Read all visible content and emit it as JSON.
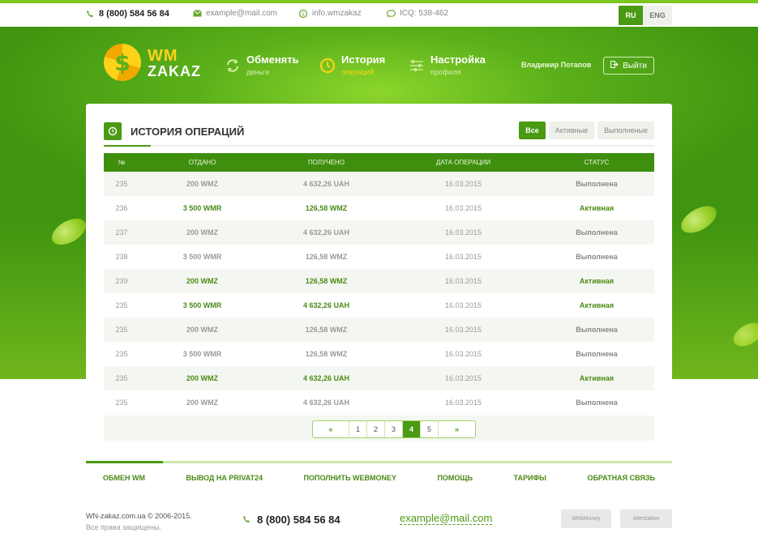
{
  "topbar": {
    "phone": "8 (800) 584 56 84",
    "email": "example@mail.com",
    "skype": "info.wmzakaz",
    "icq": "ICQ: 538-462",
    "lang_ru": "RU",
    "lang_en": "ENG"
  },
  "logo": {
    "line1": "WM",
    "line2": "ZAKAZ"
  },
  "nav": [
    {
      "title": "Обменять",
      "sub": "деньги",
      "icon": "refresh-icon"
    },
    {
      "title": "История",
      "sub": "операций",
      "icon": "clock-icon"
    },
    {
      "title": "Настройка",
      "sub": "профиля",
      "icon": "sliders-icon"
    }
  ],
  "user": {
    "name": "Владимир Потапов",
    "logout": "Выйти"
  },
  "panel": {
    "title": "ИСТОРИЯ ОПЕРАЦИЙ",
    "filters": [
      "Все",
      "Активные",
      "Выполненые"
    ]
  },
  "table": {
    "headers": [
      "№",
      "ОТДАНО",
      "ПОЛУЧЕНО",
      "ДАТА ОПЕРАЦИИ",
      "СТАТУС"
    ],
    "rows": [
      [
        "235",
        "200 WMZ",
        "4 632,26 UAH",
        "16.03.2015",
        "Выполнена"
      ],
      [
        "236",
        "3 500 WMR",
        "126,58 WMZ",
        "16.03.2015",
        "Активная"
      ],
      [
        "237",
        "200 WMZ",
        "4 632,26 UAH",
        "16.03.2015",
        "Выполнена"
      ],
      [
        "238",
        "3 500 WMR",
        "126,58 WMZ",
        "16.03.2015",
        "Выполнена"
      ],
      [
        "239",
        "200 WMZ",
        "126,58 WMZ",
        "16.03.2015",
        "Активная"
      ],
      [
        "235",
        "3 500 WMR",
        "4 632,26 UAH",
        "16.03.2015",
        "Активная"
      ],
      [
        "235",
        "200 WMZ",
        "126,58 WMZ",
        "16.03.2015",
        "Выполнена"
      ],
      [
        "235",
        "3 500 WMR",
        "126,58 WMZ",
        "16.03.2015",
        "Выполнена"
      ],
      [
        "235",
        "200 WMZ",
        "4 632,26 UAH",
        "16.03.2015",
        "Активная"
      ],
      [
        "235",
        "200 WMZ",
        "4 632,26 UAH",
        "16.03.2015",
        "Выполнена"
      ]
    ]
  },
  "pager": {
    "prev": "«",
    "next": "»",
    "pages": [
      "1",
      "2",
      "3",
      "4",
      "5"
    ],
    "current": "4"
  },
  "footer_nav": [
    "ОБМЕН WM",
    "ВЫВОД НА PRIVAT24",
    "ПОПОЛНИТЬ WEBMONEY",
    "ПОМОЩЬ",
    "ТАРИФЫ",
    "ОБРАТНАЯ СВЯЗЬ"
  ],
  "footer": {
    "copyright": "WN-zakaz.com.ua © 2006-2015.",
    "rights": "Все права защищены.",
    "phone": "8 (800) 584 56 84",
    "email": "example@mail.com",
    "badge1": "WebMoney",
    "badge2": "Attestation"
  },
  "colors": {
    "accent": "#4a9a14",
    "hero": "#5bb01a",
    "gold": "#ffd21a"
  }
}
